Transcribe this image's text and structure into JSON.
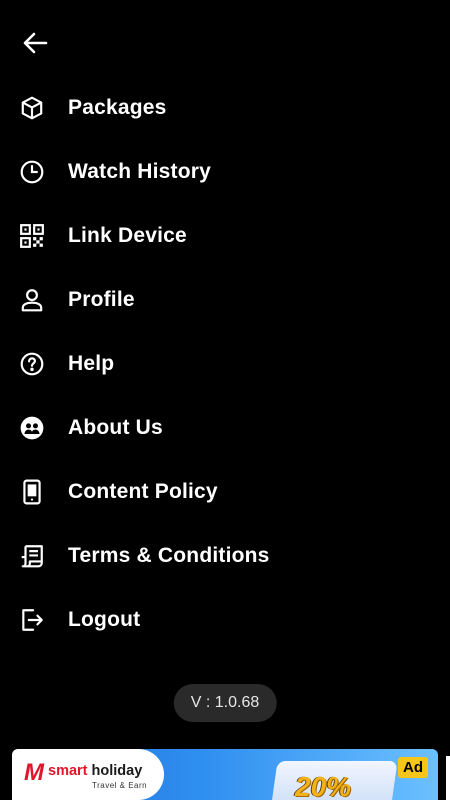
{
  "header": {
    "back_icon": "arrow-left-icon"
  },
  "menu": {
    "items": [
      {
        "label": "Packages",
        "icon": "box-icon"
      },
      {
        "label": "Watch History",
        "icon": "clock-icon"
      },
      {
        "label": "Link Device",
        "icon": "qr-code-icon"
      },
      {
        "label": "Profile",
        "icon": "person-icon"
      },
      {
        "label": "Help",
        "icon": "help-circle-icon"
      },
      {
        "label": "About Us",
        "icon": "people-circle-icon"
      },
      {
        "label": "Content Policy",
        "icon": "phone-document-icon"
      },
      {
        "label": "Terms & Conditions",
        "icon": "scroll-document-icon"
      },
      {
        "label": "Logout",
        "icon": "logout-icon"
      }
    ]
  },
  "version": "V : 1.0.68",
  "ad": {
    "brand_part1": "smart",
    "brand_part2": " holiday",
    "tagline": "Travel & Earn",
    "offer": "20%",
    "badge": "Ad"
  },
  "colors": {
    "background": "#000000",
    "text": "#ffffff",
    "version_bg": "#2a2a2a",
    "ad_badge": "#f5c518"
  }
}
